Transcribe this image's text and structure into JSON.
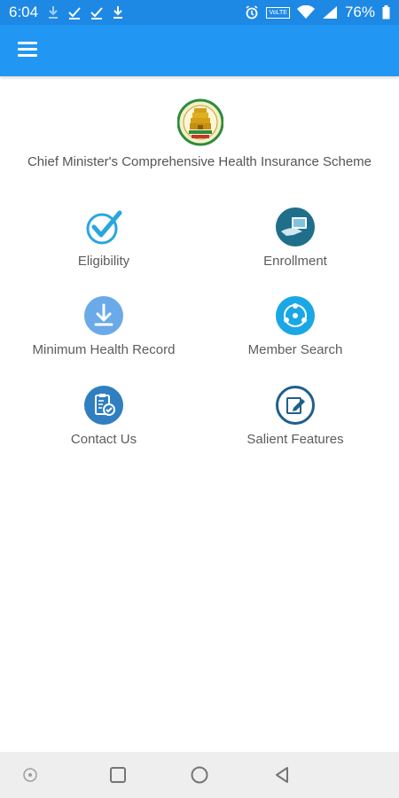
{
  "status_bar": {
    "time": "6:04",
    "battery": "76%",
    "network_badge": "VoLTE"
  },
  "header": {
    "menu_icon": "hamburger-menu-icon"
  },
  "scheme": {
    "title": "Chief Minister's Comprehensive Health Insurance Scheme",
    "emblem_icon": "tamil-nadu-emblem"
  },
  "menu": [
    {
      "label": "Eligibility",
      "icon": "check-mark-icon"
    },
    {
      "label": "Enrollment",
      "icon": "enrollment-card-icon"
    },
    {
      "label": "Minimum Health Record",
      "icon": "download-icon"
    },
    {
      "label": "Member Search",
      "icon": "member-search-icon"
    },
    {
      "label": "Contact Us",
      "icon": "clipboard-check-icon"
    },
    {
      "label": "Salient Features",
      "icon": "edit-note-icon"
    }
  ],
  "colors": {
    "app_bar": "#2196f3",
    "status_bar": "#1e88e5",
    "icon_blue": "#29a6e0",
    "icon_dark_blue": "#1f7fb8",
    "nav_bar": "#eeeeee"
  }
}
